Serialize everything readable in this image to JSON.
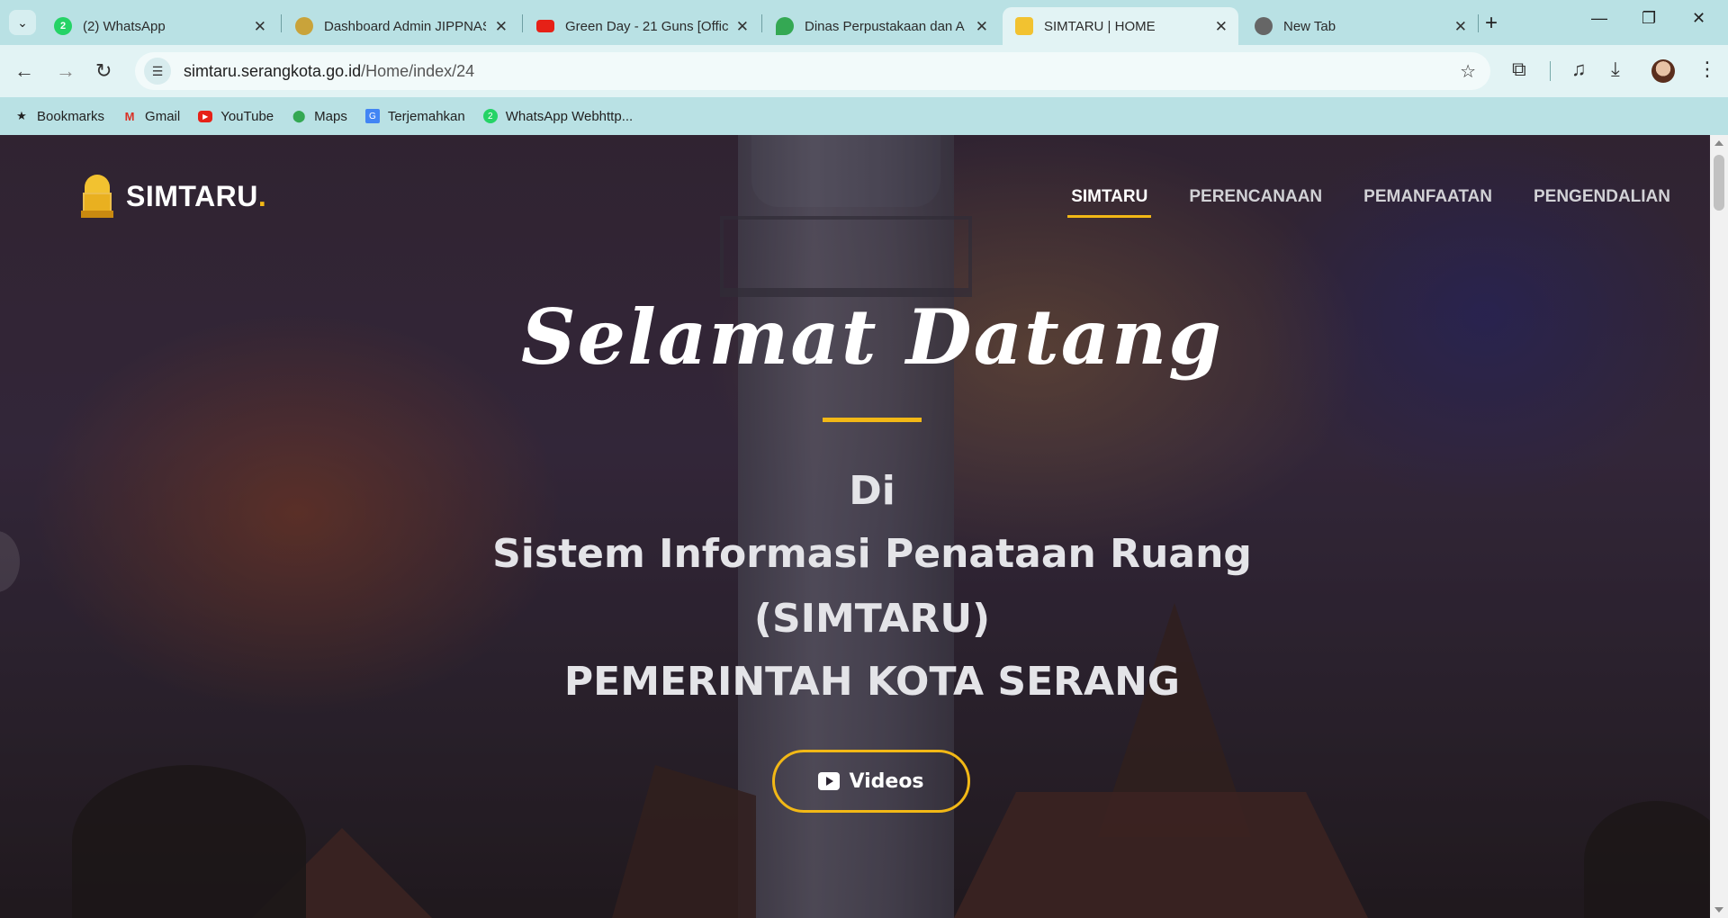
{
  "browser": {
    "tabs": [
      {
        "title": "(2) WhatsApp",
        "icon": "whatsapp-icon",
        "badge": "2"
      },
      {
        "title": "Dashboard Admin JIPPNAS",
        "icon": "garuda-icon"
      },
      {
        "title": "Green Day - 21 Guns [Offic",
        "icon": "youtube-icon"
      },
      {
        "title": "Dinas Perpustakaan dan Ar",
        "icon": "maps-icon"
      },
      {
        "title": "SIMTARU | HOME",
        "icon": "simtaru-icon",
        "active": true
      },
      {
        "title": "New Tab",
        "icon": "chrome-icon"
      }
    ],
    "url_host": "simtaru.serangkota.go.id",
    "url_path": "/Home/index/24",
    "bookmarks": [
      {
        "label": "Bookmarks",
        "icon": "star-icon"
      },
      {
        "label": "Gmail",
        "icon": "gmail-icon"
      },
      {
        "label": "YouTube",
        "icon": "youtube-icon"
      },
      {
        "label": "Maps",
        "icon": "maps-icon"
      },
      {
        "label": "Terjemahkan",
        "icon": "translate-icon"
      },
      {
        "label": "WhatsApp Webhttp...",
        "icon": "whatsapp-icon",
        "badge": "2"
      }
    ]
  },
  "site": {
    "logo_text": "SIMTARU",
    "logo_dot": ".",
    "nav": [
      "SIMTARU",
      "PERENCANAAN",
      "PEMANFAATAN",
      "PENGENDALIAN"
    ],
    "hero": {
      "greeting": "Selamat Datang",
      "line1": "Di",
      "line2": "Sistem Informasi Penataan Ruang",
      "line3": "(SIMTARU)",
      "line4": "PEMERINTAH KOTA SERANG",
      "button": "Videos"
    }
  },
  "colors": {
    "accent": "#f2b816",
    "chrome": "#b9e1e4"
  }
}
